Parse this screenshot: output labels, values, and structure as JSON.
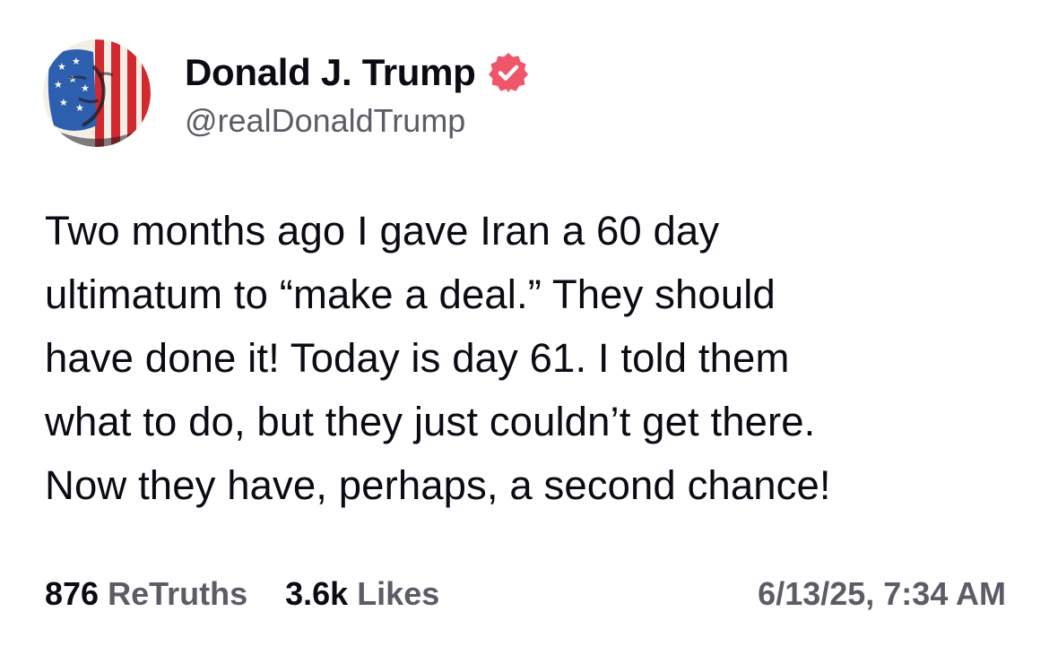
{
  "author": {
    "display_name": "Donald J. Trump",
    "handle": "@realDonaldTrump",
    "verified": true,
    "avatar_icon": "flag-portrait-avatar",
    "verified_icon": "verified-badge-icon"
  },
  "post": {
    "lines": [
      "Two months ago I gave Iran a 60 day",
      "ultimatum to “make a deal.” They should",
      "have done it! Today is day 61. I told them",
      "what to do, but they just couldn’t get there.",
      "Now they have, perhaps, a second chance!"
    ]
  },
  "stats": {
    "retruths_count": "876",
    "retruths_label": "ReTruths",
    "likes_count": "3.6k",
    "likes_label": "Likes",
    "timestamp": "6/13/25, 7:34 AM"
  },
  "colors": {
    "text_primary": "#0b0b14",
    "text_secondary": "#5c5c66",
    "verified_badge": "#f0566a",
    "flag_red": "#d4282f",
    "flag_blue": "#2e5fae",
    "background": "#ffffff"
  }
}
